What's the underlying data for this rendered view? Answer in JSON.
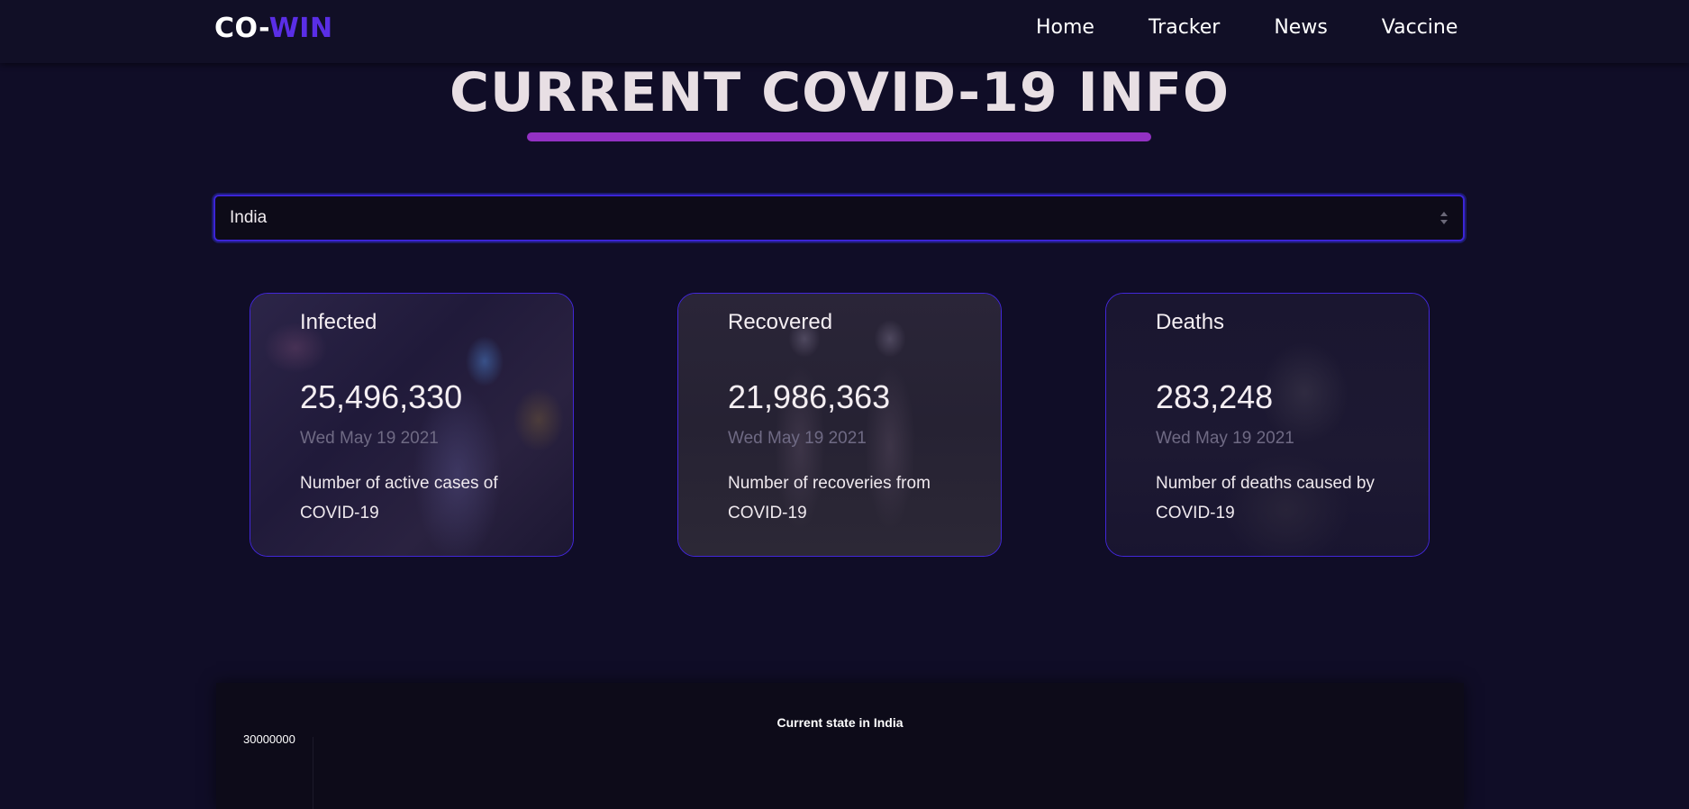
{
  "nav": {
    "brand_part1": "CO-",
    "brand_part2": "WIN",
    "links": [
      "Home",
      "Tracker",
      "News",
      "Vaccine"
    ]
  },
  "page": {
    "title": "CURRENT COVID-19 INFO"
  },
  "country_select": {
    "selected": "India"
  },
  "cards": [
    {
      "title": "Infected",
      "value": "25,496,330",
      "date": "Wed May 19 2021",
      "description": "Number of active cases of COVID-19"
    },
    {
      "title": "Recovered",
      "value": "21,986,363",
      "date": "Wed May 19 2021",
      "description": "Number of recoveries from COVID-19"
    },
    {
      "title": "Deaths",
      "value": "283,248",
      "date": "Wed May 19 2021",
      "description": "Number of deaths caused by COVID-19"
    }
  ],
  "chart": {
    "title": "Current state in India",
    "y_tick_top": "30000000"
  },
  "colors": {
    "brand_accent": "#5a2ee6",
    "title_underline": "#9331c4",
    "card_border": "#4227d8",
    "background": "#100d27"
  }
}
